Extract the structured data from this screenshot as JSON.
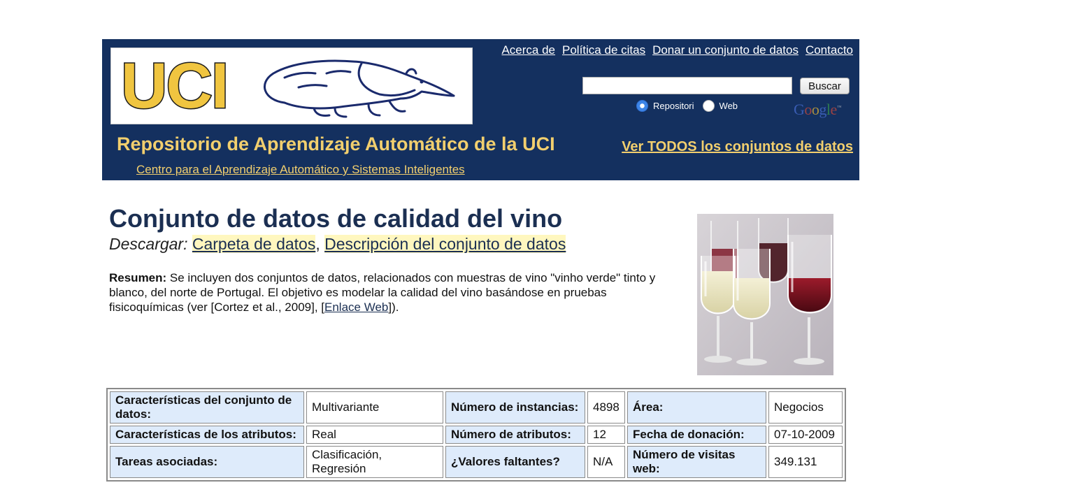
{
  "header": {
    "logo_text": "UCI",
    "top_links": [
      "Acerca de",
      "Política de citas",
      "Donar un conjunto de datos",
      "Contacto"
    ],
    "search": {
      "value": "",
      "placeholder": "",
      "button_label": "Buscar"
    },
    "radio_options": [
      {
        "label": "Repositori",
        "checked": true
      },
      {
        "label": "Web",
        "checked": false
      }
    ],
    "google_letters": [
      "G",
      "o",
      "o",
      "g",
      "l",
      "e"
    ],
    "google_tm": "™",
    "google_colors": [
      "#4a6fd6",
      "#d14a3a",
      "#e9b832",
      "#4a6fd6",
      "#3a9c4a",
      "#d14a3a"
    ],
    "repo_title": "Repositorio de Aprendizaje Automático de la UCI",
    "subtitle": "Centro para el Aprendizaje Automático y Sistemas Inteligentes",
    "view_all": "Ver TODOS los conjuntos de datos"
  },
  "dataset": {
    "title": "Conjunto de datos de calidad del vino",
    "download_label": "Descargar:",
    "download_links": [
      "Carpeta de datos",
      "Descripción del conjunto de datos"
    ],
    "download_sep": ",",
    "abstract_label": "Resumen:",
    "abstract_text": " Se incluyen dos conjuntos de datos, relacionados con muestras de vino \"vinho verde\" tinto y blanco, del norte de Portugal. El objetivo es modelar la calidad del vino basándose en pruebas fisicoquímicas (ver [Cortez et al., 2009], [",
    "abstract_link": "Enlace Web",
    "abstract_end": "])."
  },
  "table": {
    "rows": [
      [
        "Características del conjunto de datos:",
        "Multivariante",
        "Número de instancias:",
        "4898",
        "Área:",
        "Negocios"
      ],
      [
        "Características de los atributos:",
        "Real",
        "Número de atributos:",
        "12",
        "Fecha de donación:",
        "07-10-2009"
      ],
      [
        "Tareas asociadas:",
        "Clasificación, Regresión",
        "¿Valores faltantes?",
        "N/A",
        "Número de visitas web:",
        "349.131"
      ]
    ]
  },
  "colors": {
    "header_bg": "#14305f",
    "header_gold": "#f2cf6e",
    "logo_yellow": "#f0c540",
    "key_cell_bg": "#deebfb",
    "link_highlight": "#fff7bf",
    "title_color": "#1b2f52"
  },
  "icons": {
    "logo_mascot": "anteater-icon",
    "image": "wine-glasses-image"
  }
}
